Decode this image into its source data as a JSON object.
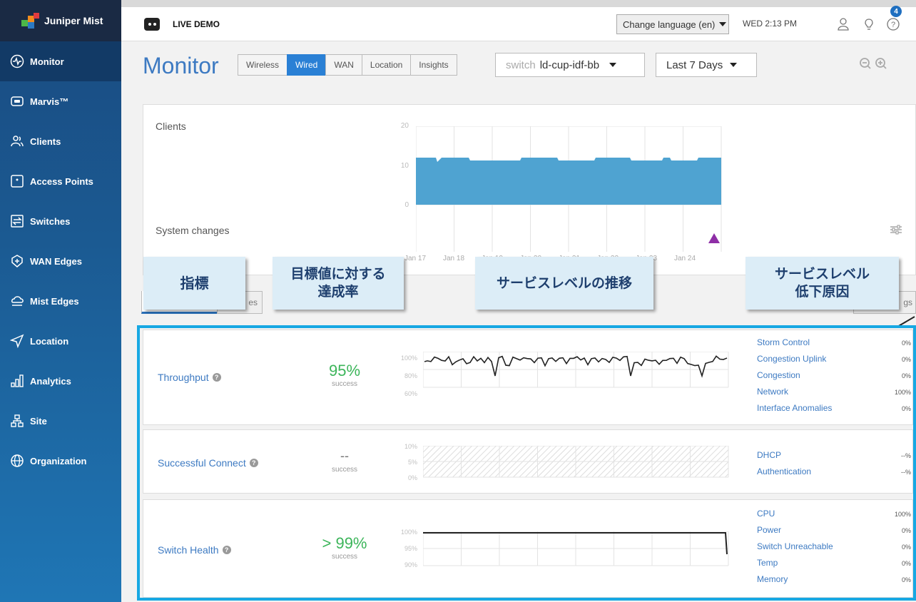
{
  "sidebar": {
    "brand": "Juniper Mist",
    "items": [
      {
        "label": "Monitor",
        "icon": "pulse-icon"
      },
      {
        "label": "Marvis™",
        "icon": "marvis-icon"
      },
      {
        "label": "Clients",
        "icon": "clients-icon"
      },
      {
        "label": "Access Points",
        "icon": "access-point-icon"
      },
      {
        "label": "Switches",
        "icon": "switch-icon"
      },
      {
        "label": "WAN Edges",
        "icon": "wan-edge-icon"
      },
      {
        "label": "Mist Edges",
        "icon": "mist-edge-icon"
      },
      {
        "label": "Location",
        "icon": "location-icon"
      },
      {
        "label": "Analytics",
        "icon": "analytics-icon"
      },
      {
        "label": "Site",
        "icon": "site-icon"
      },
      {
        "label": "Organization",
        "icon": "globe-icon"
      }
    ]
  },
  "topbar": {
    "org_name": "LIVE DEMO",
    "language": "Change language (en)",
    "datetime": "WED 2:13 PM",
    "help_badge": "4"
  },
  "monitor": {
    "title": "Monitor",
    "tabs": [
      "Wireless",
      "Wired",
      "WAN",
      "Location",
      "Insights"
    ],
    "active_tab": "Wired",
    "switch_prefix": "switch",
    "switch_value": "ld-cup-idf-bb",
    "period": "Last 7 Days"
  },
  "timeline": {
    "clients_label": "Clients",
    "system_changes_label": "System changes",
    "y_ticks": [
      "20",
      "10",
      "0"
    ],
    "x_ticks": [
      "Jan 17",
      "Jan 18",
      "Jan 19",
      "Jan 20",
      "Jan 21",
      "Jan 22",
      "Jan 23",
      "Jan 24"
    ],
    "bar_color": "#4fa3d1",
    "marker_color": "#8e2ea6"
  },
  "callouts": {
    "metric": "指標",
    "achievement": "目標値に対する\n達成率",
    "trend": "サービスレベルの推移",
    "cause": "サービスレベル\n低下原因"
  },
  "subtabs": {
    "left_partial": "es",
    "right_partial": "gs"
  },
  "sle": [
    {
      "name": "Throughput",
      "value": "95%",
      "success_label": "success",
      "axis": [
        "100%",
        "80%",
        "60%"
      ],
      "classifiers": [
        {
          "name": "Storm Control",
          "value": "0%"
        },
        {
          "name": "Congestion Uplink",
          "value": "0%"
        },
        {
          "name": "Congestion",
          "value": "0%"
        },
        {
          "name": "Network",
          "value": "100%"
        },
        {
          "name": "Interface Anomalies",
          "value": "0%"
        }
      ]
    },
    {
      "name": "Successful Connect",
      "value": "--",
      "success_label": "success",
      "axis": [
        "10%",
        "5%",
        "0%"
      ],
      "classifiers": [
        {
          "name": "DHCP",
          "value": "--%"
        },
        {
          "name": "Authentication",
          "value": "--%"
        }
      ]
    },
    {
      "name": "Switch Health",
      "value": "> 99%",
      "success_label": "success",
      "axis": [
        "100%",
        "95%",
        "90%"
      ],
      "classifiers": [
        {
          "name": "CPU",
          "value": "100%"
        },
        {
          "name": "Power",
          "value": "0%"
        },
        {
          "name": "Switch Unreachable",
          "value": "0%"
        },
        {
          "name": "Temp",
          "value": "0%"
        },
        {
          "name": "Memory",
          "value": "0%"
        }
      ]
    }
  ]
}
